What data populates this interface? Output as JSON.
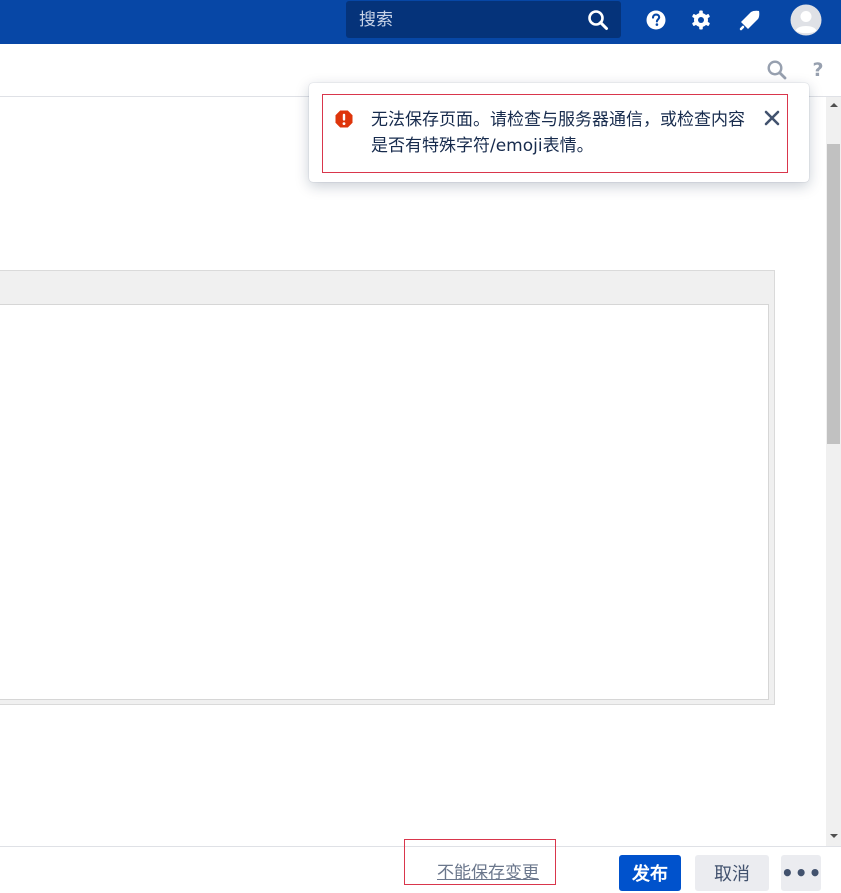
{
  "header": {
    "search": {
      "placeholder": "搜索",
      "icon": "search-icon"
    },
    "icons": [
      "help-icon",
      "settings-icon",
      "notifications-icon",
      "avatar"
    ]
  },
  "toolbar": {
    "icons": [
      "search-icon",
      "help-icon"
    ],
    "help_glyph": "?"
  },
  "notification": {
    "type": "error",
    "message": "无法保存页面。请检查与服务器通信，或检查内容是否有特殊字符/emoji表情。",
    "icon": "error-icon",
    "close_icon": "close-icon"
  },
  "footer": {
    "status": "不能保存变更",
    "publish_label": "发布",
    "cancel_label": "取消",
    "more_label": "•••"
  },
  "colors": {
    "nav_bg": "#0747a6",
    "primary": "#0052cc",
    "error": "#de350b",
    "highlight": "#d9364c"
  }
}
